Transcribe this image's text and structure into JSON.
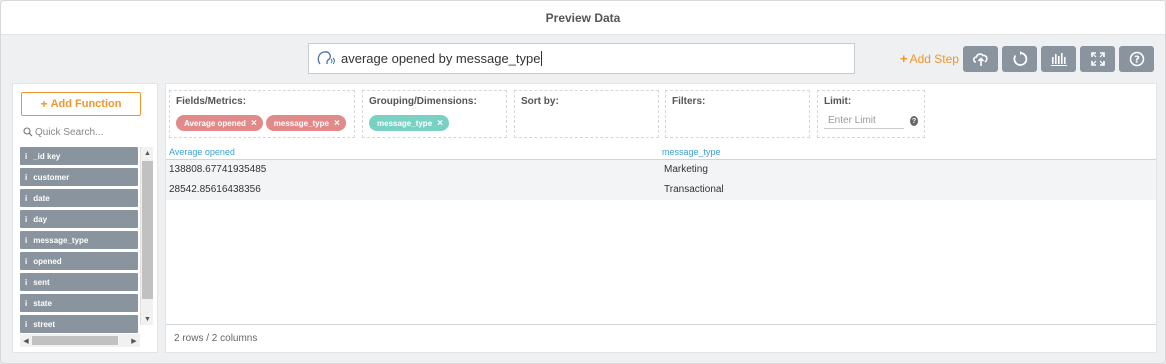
{
  "title": "Preview Data",
  "query": {
    "text": "average opened by message_type",
    "icon": "voice-query-icon"
  },
  "toolbar": {
    "add_step_label": "Add Step",
    "buttons": [
      {
        "name": "cloud-upload-button",
        "icon": "cloud-upload-icon"
      },
      {
        "name": "refresh-button",
        "icon": "refresh-icon"
      },
      {
        "name": "chart-button",
        "icon": "bar-chart-icon"
      },
      {
        "name": "fullscreen-button",
        "icon": "expand-icon"
      },
      {
        "name": "help-button",
        "icon": "question-icon"
      }
    ],
    "accent": "#f0952b",
    "button_color": "#8a949e"
  },
  "sidebar": {
    "add_function_label": "Add Function",
    "search_placeholder": "Quick Search...",
    "fields": [
      {
        "icon": "i",
        "label": "_id key"
      },
      {
        "icon": "i",
        "label": "customer"
      },
      {
        "icon": "i",
        "label": "date"
      },
      {
        "icon": "i",
        "label": "day"
      },
      {
        "icon": "i",
        "label": "message_type"
      },
      {
        "icon": "i",
        "label": "opened"
      },
      {
        "icon": "i",
        "label": "sent"
      },
      {
        "icon": "i",
        "label": "state"
      },
      {
        "icon": "i",
        "label": "street"
      }
    ]
  },
  "builder": {
    "fields_metrics_label": "Fields/Metrics:",
    "fields_metrics_pills": [
      {
        "label": "Average opened",
        "color": "#e28a8a"
      },
      {
        "label": "message_type",
        "color": "#e28a8a"
      }
    ],
    "grouping_label": "Grouping/Dimensions:",
    "grouping_pills": [
      {
        "label": "message_type",
        "color": "#79d1c4"
      }
    ],
    "sort_label": "Sort by:",
    "filters_label": "Filters:",
    "limit_label": "Limit:",
    "limit_placeholder": "Enter Limit"
  },
  "table": {
    "columns": [
      "Average opened",
      "message_type"
    ],
    "rows": [
      [
        "138808.67741935485",
        "Marketing"
      ],
      [
        "28542.85616438356",
        "Transactional"
      ]
    ],
    "header_color": "#3aa3d0"
  },
  "footer": {
    "summary": "2 rows / 2 columns"
  }
}
